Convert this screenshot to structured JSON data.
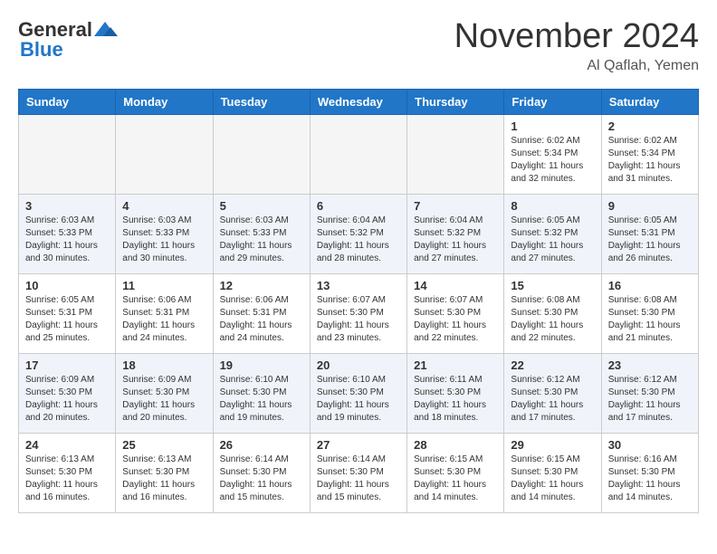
{
  "header": {
    "logo_general": "General",
    "logo_blue": "Blue",
    "title": "November 2024",
    "location": "Al Qaflah, Yemen"
  },
  "days_of_week": [
    "Sunday",
    "Monday",
    "Tuesday",
    "Wednesday",
    "Thursday",
    "Friday",
    "Saturday"
  ],
  "weeks": [
    [
      {
        "day": "",
        "info": ""
      },
      {
        "day": "",
        "info": ""
      },
      {
        "day": "",
        "info": ""
      },
      {
        "day": "",
        "info": ""
      },
      {
        "day": "",
        "info": ""
      },
      {
        "day": "1",
        "info": "Sunrise: 6:02 AM\nSunset: 5:34 PM\nDaylight: 11 hours\nand 32 minutes."
      },
      {
        "day": "2",
        "info": "Sunrise: 6:02 AM\nSunset: 5:34 PM\nDaylight: 11 hours\nand 31 minutes."
      }
    ],
    [
      {
        "day": "3",
        "info": "Sunrise: 6:03 AM\nSunset: 5:33 PM\nDaylight: 11 hours\nand 30 minutes."
      },
      {
        "day": "4",
        "info": "Sunrise: 6:03 AM\nSunset: 5:33 PM\nDaylight: 11 hours\nand 30 minutes."
      },
      {
        "day": "5",
        "info": "Sunrise: 6:03 AM\nSunset: 5:33 PM\nDaylight: 11 hours\nand 29 minutes."
      },
      {
        "day": "6",
        "info": "Sunrise: 6:04 AM\nSunset: 5:32 PM\nDaylight: 11 hours\nand 28 minutes."
      },
      {
        "day": "7",
        "info": "Sunrise: 6:04 AM\nSunset: 5:32 PM\nDaylight: 11 hours\nand 27 minutes."
      },
      {
        "day": "8",
        "info": "Sunrise: 6:05 AM\nSunset: 5:32 PM\nDaylight: 11 hours\nand 27 minutes."
      },
      {
        "day": "9",
        "info": "Sunrise: 6:05 AM\nSunset: 5:31 PM\nDaylight: 11 hours\nand 26 minutes."
      }
    ],
    [
      {
        "day": "10",
        "info": "Sunrise: 6:05 AM\nSunset: 5:31 PM\nDaylight: 11 hours\nand 25 minutes."
      },
      {
        "day": "11",
        "info": "Sunrise: 6:06 AM\nSunset: 5:31 PM\nDaylight: 11 hours\nand 24 minutes."
      },
      {
        "day": "12",
        "info": "Sunrise: 6:06 AM\nSunset: 5:31 PM\nDaylight: 11 hours\nand 24 minutes."
      },
      {
        "day": "13",
        "info": "Sunrise: 6:07 AM\nSunset: 5:30 PM\nDaylight: 11 hours\nand 23 minutes."
      },
      {
        "day": "14",
        "info": "Sunrise: 6:07 AM\nSunset: 5:30 PM\nDaylight: 11 hours\nand 22 minutes."
      },
      {
        "day": "15",
        "info": "Sunrise: 6:08 AM\nSunset: 5:30 PM\nDaylight: 11 hours\nand 22 minutes."
      },
      {
        "day": "16",
        "info": "Sunrise: 6:08 AM\nSunset: 5:30 PM\nDaylight: 11 hours\nand 21 minutes."
      }
    ],
    [
      {
        "day": "17",
        "info": "Sunrise: 6:09 AM\nSunset: 5:30 PM\nDaylight: 11 hours\nand 20 minutes."
      },
      {
        "day": "18",
        "info": "Sunrise: 6:09 AM\nSunset: 5:30 PM\nDaylight: 11 hours\nand 20 minutes."
      },
      {
        "day": "19",
        "info": "Sunrise: 6:10 AM\nSunset: 5:30 PM\nDaylight: 11 hours\nand 19 minutes."
      },
      {
        "day": "20",
        "info": "Sunrise: 6:10 AM\nSunset: 5:30 PM\nDaylight: 11 hours\nand 19 minutes."
      },
      {
        "day": "21",
        "info": "Sunrise: 6:11 AM\nSunset: 5:30 PM\nDaylight: 11 hours\nand 18 minutes."
      },
      {
        "day": "22",
        "info": "Sunrise: 6:12 AM\nSunset: 5:30 PM\nDaylight: 11 hours\nand 17 minutes."
      },
      {
        "day": "23",
        "info": "Sunrise: 6:12 AM\nSunset: 5:30 PM\nDaylight: 11 hours\nand 17 minutes."
      }
    ],
    [
      {
        "day": "24",
        "info": "Sunrise: 6:13 AM\nSunset: 5:30 PM\nDaylight: 11 hours\nand 16 minutes."
      },
      {
        "day": "25",
        "info": "Sunrise: 6:13 AM\nSunset: 5:30 PM\nDaylight: 11 hours\nand 16 minutes."
      },
      {
        "day": "26",
        "info": "Sunrise: 6:14 AM\nSunset: 5:30 PM\nDaylight: 11 hours\nand 15 minutes."
      },
      {
        "day": "27",
        "info": "Sunrise: 6:14 AM\nSunset: 5:30 PM\nDaylight: 11 hours\nand 15 minutes."
      },
      {
        "day": "28",
        "info": "Sunrise: 6:15 AM\nSunset: 5:30 PM\nDaylight: 11 hours\nand 14 minutes."
      },
      {
        "day": "29",
        "info": "Sunrise: 6:15 AM\nSunset: 5:30 PM\nDaylight: 11 hours\nand 14 minutes."
      },
      {
        "day": "30",
        "info": "Sunrise: 6:16 AM\nSunset: 5:30 PM\nDaylight: 11 hours\nand 14 minutes."
      }
    ]
  ]
}
